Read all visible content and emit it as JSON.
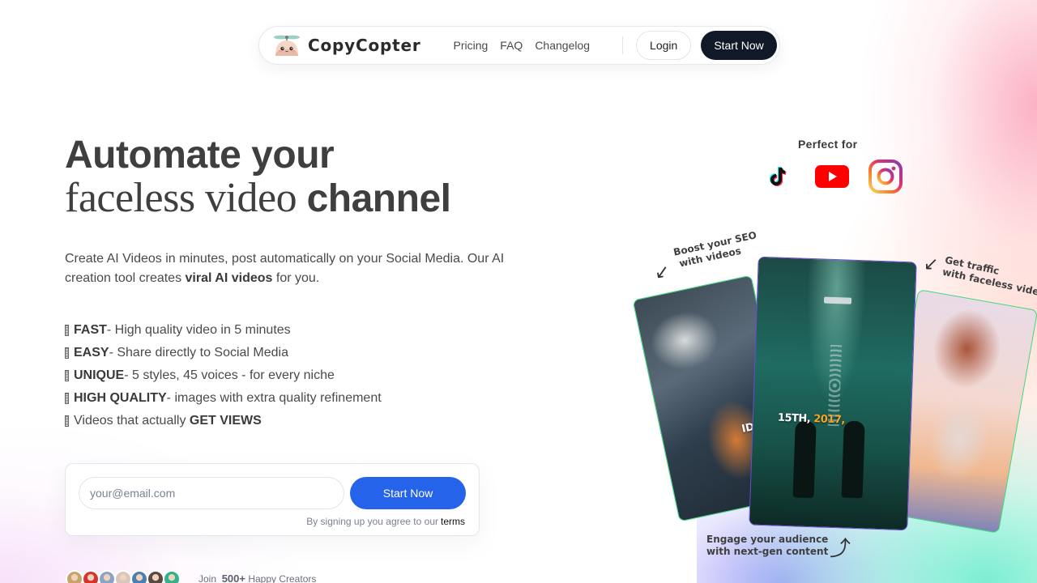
{
  "nav": {
    "brand": "CopyCopter",
    "links": [
      "Pricing",
      "FAQ",
      "Changelog"
    ],
    "login_label": "Login",
    "start_label": "Start Now"
  },
  "hero": {
    "title_line1": "Automate your",
    "title_line2_serif": "faceless video ",
    "title_line2_bold": "channel",
    "desc_part1": "Create AI Videos in minutes, post automatically on your Social Media. Our AI creation tool creates ",
    "desc_bold": "viral AI videos",
    "desc_part2": " for you."
  },
  "features": [
    {
      "bold": "FAST",
      "text": " - High quality video in 5 minutes"
    },
    {
      "bold": "EASY",
      "text": " - Share directly to Social Media"
    },
    {
      "bold": "UNIQUE",
      "text": " - 5 styles, 45 voices - for every niche"
    },
    {
      "bold": "HIGH QUALITY",
      "text": " - images with extra quality refinement"
    },
    {
      "prefix": "Videos that actually ",
      "bold": "GET VIEWS"
    }
  ],
  "signup": {
    "email_placeholder": "your@email.com",
    "button_label": "Start Now",
    "terms_text": "By signing up you agree to our",
    "terms_link": "terms"
  },
  "social_proof": {
    "join": "Join",
    "count": "500+",
    "suffix": "Happy Creators",
    "avatar_colors": [
      "#c9a46a",
      "#d9342b",
      "#8aa4c4",
      "#d9c7bd",
      "#4a7fb0",
      "#5a4a40",
      "#2fb38c"
    ]
  },
  "platforms": {
    "heading": "Perfect for",
    "items": [
      "TikTok",
      "YouTube",
      "Instagram"
    ]
  },
  "showcase": {
    "annot_seo_1": "Boost your SEO",
    "annot_seo_2": "with videos",
    "annot_traffic_1": "Get traffic",
    "annot_traffic_2": "with faceless video",
    "annot_engage_1": "Engage your audience",
    "annot_engage_2": "with next-gen content",
    "card_left_caption": "IDEAL",
    "card_center_caption_white": "15TH, ",
    "card_center_caption_highlight": "2017,"
  },
  "colors": {
    "primary": "#2563eb",
    "nav_button": "#111827",
    "text": "#3f3f3f",
    "card_border_green": "#3ed67d",
    "card_border_purple": "#6c4ad0"
  }
}
